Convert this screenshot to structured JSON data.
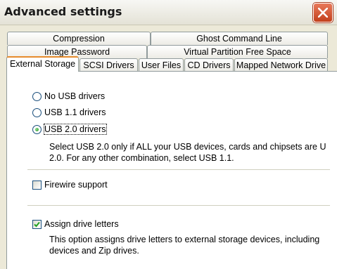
{
  "window": {
    "title": "Advanced settings"
  },
  "tabs": {
    "row1": [
      "Compression",
      "Ghost Command Line"
    ],
    "row2": [
      "Image Password",
      "Virtual Partition Free Space"
    ],
    "row3": [
      "External Storage",
      "SCSI Drivers",
      "User Files",
      "CD Drivers",
      "Mapped Network Drive"
    ]
  },
  "usb": {
    "options": [
      {
        "label": "No USB drivers",
        "selected": false
      },
      {
        "label": "USB 1.1 drivers",
        "selected": false
      },
      {
        "label": "USB 2.0 drivers",
        "selected": true
      }
    ],
    "note": "Select USB 2.0 only if ALL your USB devices, cards and chipsets are U\n2.0. For any other combination, select USB 1.1."
  },
  "firewire": {
    "label": "Firewire support",
    "checked": false
  },
  "drive_letters": {
    "label": "Assign drive letters",
    "checked": true,
    "note": "This option assigns drive letters to external storage devices, including\ndevices and Zip drives."
  }
}
